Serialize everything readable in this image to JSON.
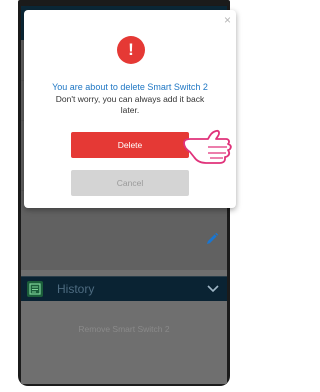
{
  "dialog": {
    "close_glyph": "×",
    "alert_glyph": "!",
    "title": "You are about to delete Smart Switch 2",
    "message": "Don't worry, you can always add it back later.",
    "delete_label": "Delete",
    "cancel_label": "Cancel"
  },
  "background": {
    "history_label": "History",
    "remove_label": "Remove Smart Switch 2"
  },
  "colors": {
    "accent_red": "#e53935",
    "title_blue": "#1f77c4",
    "header_navy": "#0b2838"
  },
  "icons": [
    "close-icon",
    "alert-icon",
    "edit-icon",
    "history-icon",
    "chevron-down-icon",
    "pointing-hand-icon"
  ]
}
